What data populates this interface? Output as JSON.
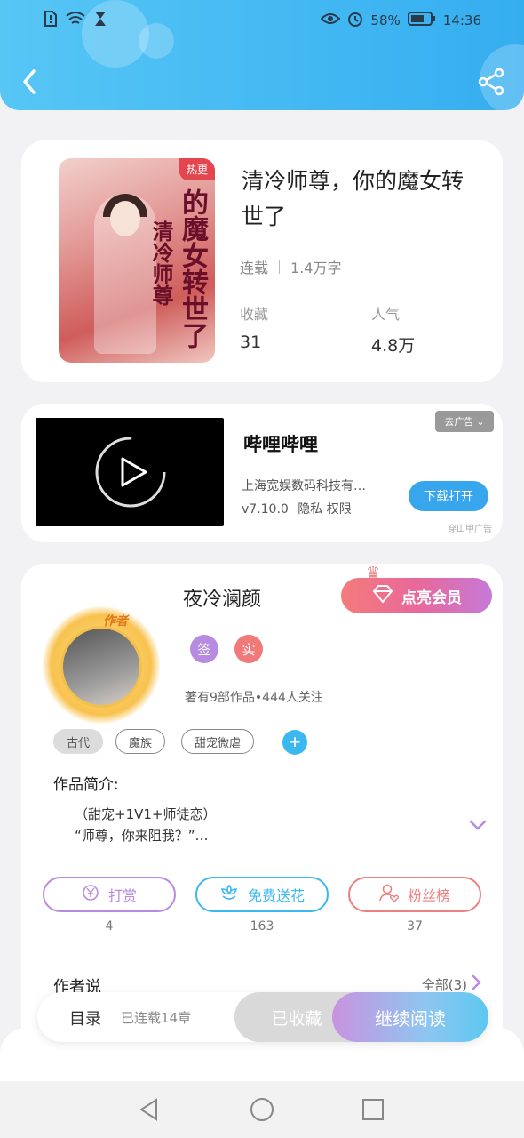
{
  "status_bar": {
    "battery": "58%",
    "time": "14:36"
  },
  "header": {
    "back_icon": "chevron-left-icon",
    "share_icon": "share-icon"
  },
  "book": {
    "cover_tag": "热更",
    "cover_title_main": "的魔女转世了",
    "cover_title_sub": "清冷师尊",
    "title": "清冷师尊，你的魔女转世了",
    "status": "连载",
    "word_count": "1.4万字",
    "stats": [
      {
        "label": "收藏",
        "value": "31"
      },
      {
        "label": "人气",
        "value": "4.8万"
      }
    ]
  },
  "ad": {
    "app_name": "哔哩哔哩",
    "company": "上海宽娱数码科技有…",
    "version": "v7.10.0",
    "links": "隐私  权限",
    "download_label": "下载打开",
    "close_label": "去广告",
    "source": "穿山甲广告"
  },
  "author": {
    "badge": "作者",
    "name": "夜冷澜颜",
    "vip_label": "点亮会员",
    "badges": [
      {
        "text": "签",
        "color": "#b78be0"
      },
      {
        "text": "实",
        "color": "#f07a7a"
      }
    ],
    "works_info": "著有9部作品•444人关注",
    "tags": [
      "古代",
      "魔族",
      "甜宠微虐"
    ],
    "intro_label": "作品简介:",
    "intro_lines": [
      "（甜宠+1V1+师徒恋）",
      "“师尊，你来阻我？”…"
    ],
    "actions": [
      {
        "label": "打赏",
        "count": "4",
        "color": "#b98be0",
        "icon": "yen-coin-icon"
      },
      {
        "label": "免费送花",
        "count": "163",
        "color": "#3cb8f0",
        "icon": "flower-icon"
      },
      {
        "label": "粉丝榜",
        "count": "37",
        "color": "#ef7f7f",
        "icon": "fan-user-icon"
      }
    ],
    "say_label": "作者说",
    "say_all": "全部(3)"
  },
  "bottom_bar": {
    "toc_label": "目录",
    "chapters": "已连载14章",
    "favorited_label": "已收藏",
    "read_label": "继续阅读"
  }
}
